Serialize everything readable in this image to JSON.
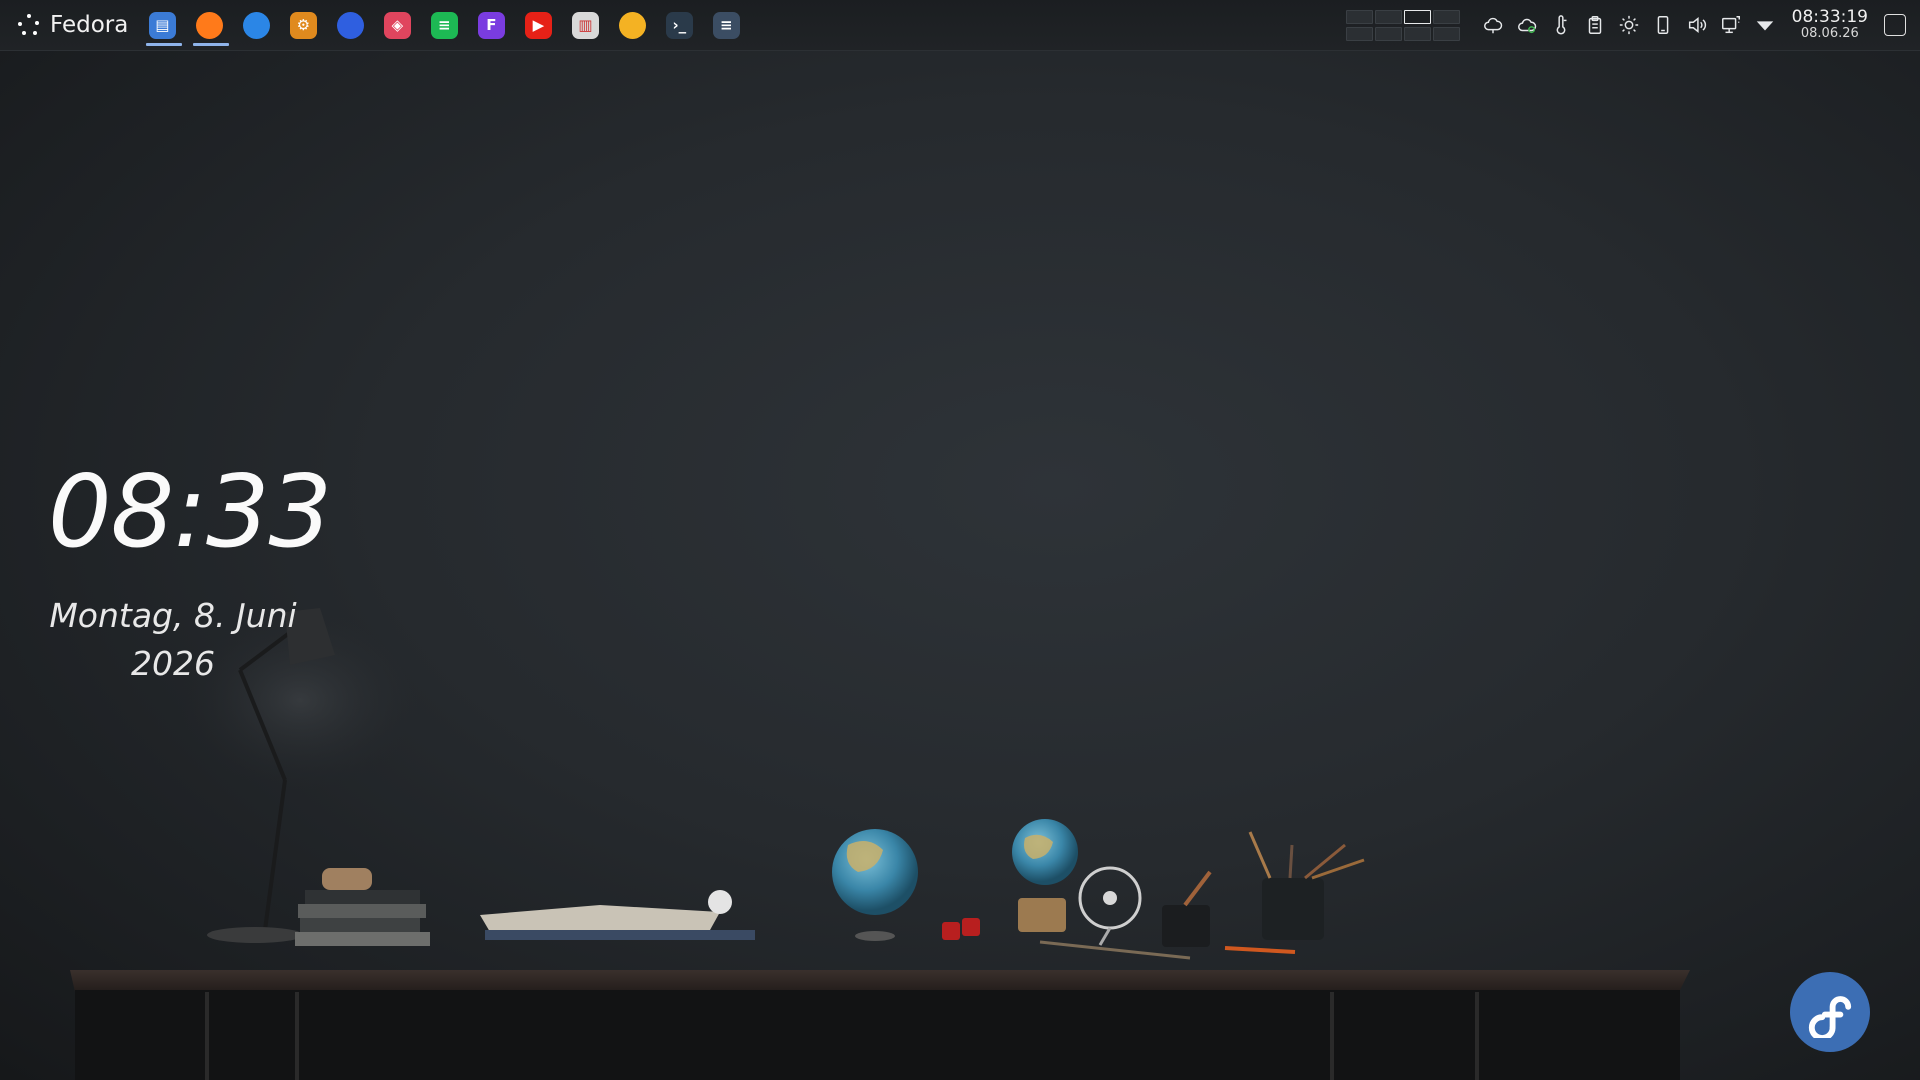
{
  "panel": {
    "launcher_label": "Fedora",
    "taskbar": [
      {
        "name": "file-manager",
        "color": "#3b7bd6",
        "glyph": "▤",
        "active": true
      },
      {
        "name": "firefox",
        "color": "#ff7a1a",
        "glyph": "",
        "active": true
      },
      {
        "name": "thunderbird",
        "color": "#2b86e6",
        "glyph": "",
        "active": false
      },
      {
        "name": "system-settings",
        "color": "#e08a1e",
        "glyph": "⚙",
        "active": false
      },
      {
        "name": "browser-blue",
        "color": "#2f5fe0",
        "glyph": "",
        "active": false
      },
      {
        "name": "package-box",
        "color": "#e0455e",
        "glyph": "◈",
        "active": false
      },
      {
        "name": "spotify",
        "color": "#1db954",
        "glyph": "≡",
        "active": false
      },
      {
        "name": "app-purple",
        "color": "#7a3ce0",
        "glyph": "F",
        "active": false
      },
      {
        "name": "youtube",
        "color": "#e62117",
        "glyph": "▶",
        "active": false
      },
      {
        "name": "archive",
        "color": "#d9d9d9",
        "glyph": "▥",
        "active": false
      },
      {
        "name": "weather",
        "color": "#f4b223",
        "glyph": "",
        "active": false
      },
      {
        "name": "terminal",
        "color": "#2a3a4a",
        "glyph": "›_",
        "active": false
      },
      {
        "name": "mixer-settings",
        "color": "#3b4d63",
        "glyph": "≡",
        "active": false
      }
    ],
    "tray": [
      {
        "name": "weather-cloud-icon"
      },
      {
        "name": "cloud-sync-icon"
      },
      {
        "name": "thermometer-icon"
      },
      {
        "name": "clipboard-icon"
      },
      {
        "name": "brightness-icon"
      },
      {
        "name": "phone-connect-icon"
      },
      {
        "name": "volume-icon"
      },
      {
        "name": "display-network-icon"
      },
      {
        "name": "tray-expand-arrow-icon"
      }
    ],
    "clock_time": "08:33:19",
    "clock_date": "08.06.26"
  },
  "desktop": {
    "clock_time": "08:33",
    "date_line1": "Montag, 8. Juni",
    "date_line2": "2026"
  },
  "colors": {
    "accent": "#8fb4ea",
    "fedora_blue": "#3c6eb4"
  }
}
